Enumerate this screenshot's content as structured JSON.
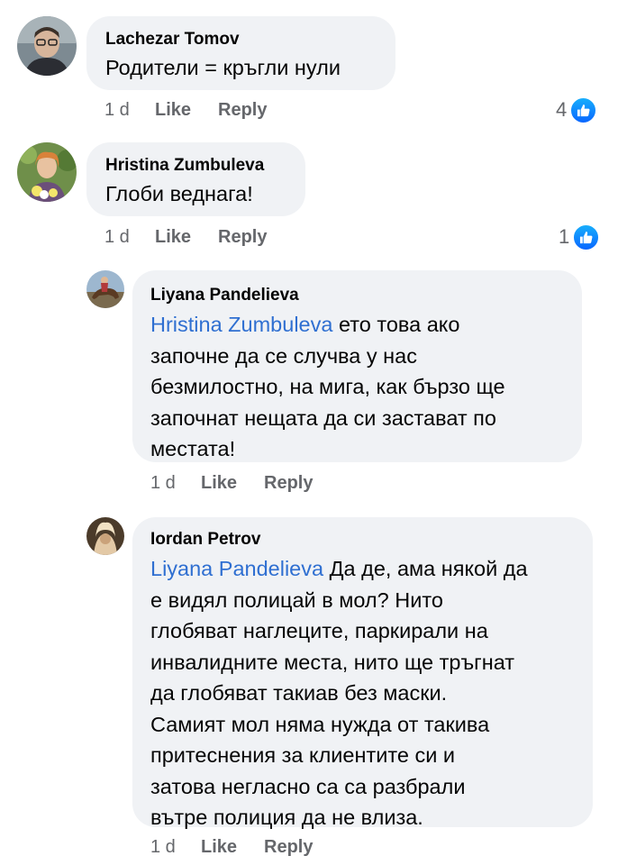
{
  "comments": [
    {
      "author": "Lachezar Tomov",
      "text": "Родители = кръгли нули",
      "time": "1 d",
      "like_label": "Like",
      "reply_label": "Reply",
      "reaction_count": "4",
      "reaction_icon": "thumbs-up-icon"
    },
    {
      "author": "Hristina Zumbuleva",
      "text": "Глоби веднага!",
      "time": "1 d",
      "like_label": "Like",
      "reply_label": "Reply",
      "reaction_count": "1",
      "reaction_icon": "thumbs-up-icon",
      "replies": [
        {
          "author": "Liyana Pandelieva",
          "mention": "Hristina Zumbuleva",
          "text_lines": [
            " ето това ако",
            "започне да се случва у нас",
            "безмилостно, на мига, как бързо ще",
            "започнат нещата да си застават по",
            "местата!"
          ],
          "time": "1 d",
          "like_label": "Like",
          "reply_label": "Reply"
        },
        {
          "author": "Iordan Petrov",
          "mention": "Liyana Pandelieva",
          "text_lines": [
            " Да де, ама някой да",
            "е видял полицай в мол? Нито",
            "глобяват наглеците, паркирали на",
            "инвалидните места, нито ще тръгнат",
            "да глобяват такиав без маски.",
            "Самият мол няма нужда от такива",
            "притеснения за клиентите си и",
            "затова негласно са са разбрали",
            "вътре полиция да не влиза."
          ],
          "time": "1 d",
          "like_label": "Like",
          "reply_label": "Reply"
        }
      ]
    }
  ],
  "colors": {
    "bubble": "#f0f2f5",
    "mention": "#2f6fd1",
    "meta": "#65676b",
    "like_blue": "#0866ff"
  }
}
